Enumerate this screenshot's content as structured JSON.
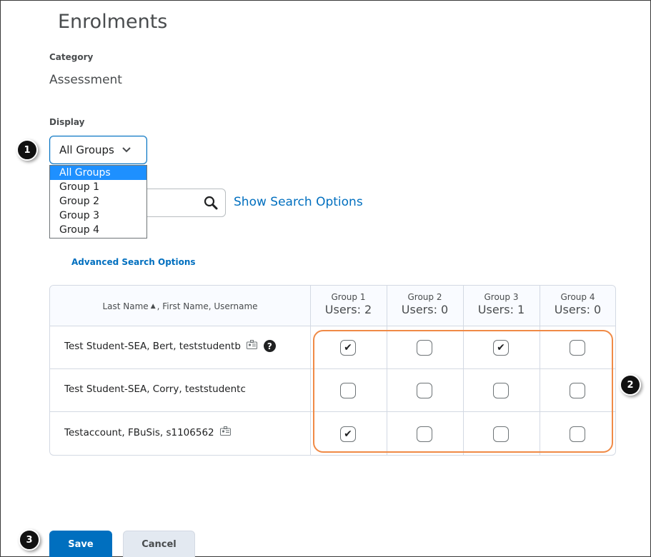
{
  "page": {
    "title": "Enrolments"
  },
  "category": {
    "label": "Category",
    "value": "Assessment"
  },
  "display": {
    "label": "Display",
    "selected": "All Groups",
    "options": [
      "All Groups",
      "Group 1",
      "Group 2",
      "Group 3",
      "Group 4"
    ]
  },
  "search": {
    "show_options": "Show Search Options",
    "advanced": "Advanced Search Options"
  },
  "table": {
    "name_header_a": "Last Name",
    "name_header_b": ", First Name, Username",
    "groups": [
      {
        "name": "Group 1",
        "users": "Users: 2"
      },
      {
        "name": "Group 2",
        "users": "Users: 0"
      },
      {
        "name": "Group 3",
        "users": "Users: 1"
      },
      {
        "name": "Group 4",
        "users": "Users: 0"
      }
    ],
    "rows": [
      {
        "name": "Test Student-SEA, Bert, teststudentb",
        "checks": [
          true,
          false,
          true,
          false
        ]
      },
      {
        "name": "Test Student-SEA, Corry, teststudentc",
        "checks": [
          false,
          false,
          false,
          false
        ]
      },
      {
        "name": "Testaccount, FBuSis, s1106562",
        "checks": [
          true,
          false,
          false,
          false
        ]
      }
    ]
  },
  "buttons": {
    "save": "Save",
    "cancel": "Cancel"
  },
  "callouts": [
    "1",
    "2",
    "3"
  ],
  "colors": {
    "accent": "#006fbf",
    "highlight": "#f08a46",
    "selected_option": "#1e90ff"
  }
}
